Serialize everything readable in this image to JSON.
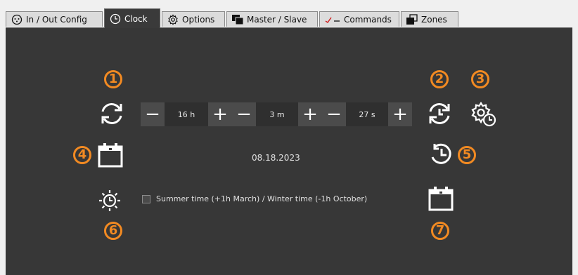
{
  "tabs": [
    {
      "label": "In / Out Config",
      "icon": "connector-icon"
    },
    {
      "label": "Clock",
      "icon": "clock-icon"
    },
    {
      "label": "Options",
      "icon": "gear-icon"
    },
    {
      "label": "Master / Slave",
      "icon": "master-slave-icon"
    },
    {
      "label": "Commands",
      "icon": "commands-icon"
    },
    {
      "label": "Zones",
      "icon": "zones-icon"
    }
  ],
  "active_tab": "Clock",
  "clock": {
    "hours": {
      "value": "16 h",
      "minus": "−",
      "plus": "+"
    },
    "minutes": {
      "value": "3 m",
      "minus": "−",
      "plus": "+"
    },
    "seconds": {
      "value": "27 s",
      "minus": "−",
      "plus": "+"
    },
    "date": "08.18.2023",
    "dst_label": "Summer time (+1h March) / Winter time (-1h October)",
    "dst_checked": false
  },
  "badges": [
    "1",
    "2",
    "3",
    "4",
    "5",
    "6",
    "7"
  ],
  "colors": {
    "accent": "#f28a22",
    "panel": "#373737",
    "tab_active": "#3a3a3a",
    "tab_inactive": "#dcdcdc"
  }
}
